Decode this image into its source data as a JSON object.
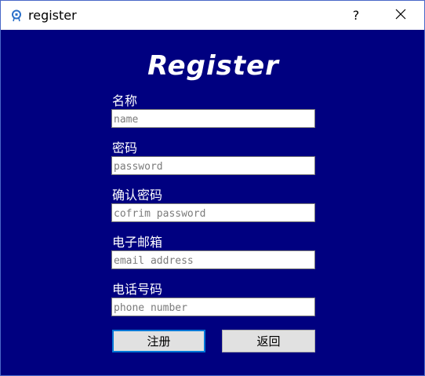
{
  "window": {
    "title": "register",
    "help_label": "?"
  },
  "form": {
    "heading": "Register",
    "fields": [
      {
        "label": "名称",
        "placeholder": "name",
        "value": ""
      },
      {
        "label": "密码",
        "placeholder": "password",
        "value": ""
      },
      {
        "label": "确认密码",
        "placeholder": "cofrim password",
        "value": ""
      },
      {
        "label": "电子邮箱",
        "placeholder": "email address",
        "value": ""
      },
      {
        "label": "电话号码",
        "placeholder": "phone number",
        "value": ""
      }
    ],
    "submit_label": "注册",
    "back_label": "返回"
  },
  "colors": {
    "background": "#000080",
    "accent": "#0078d7"
  }
}
